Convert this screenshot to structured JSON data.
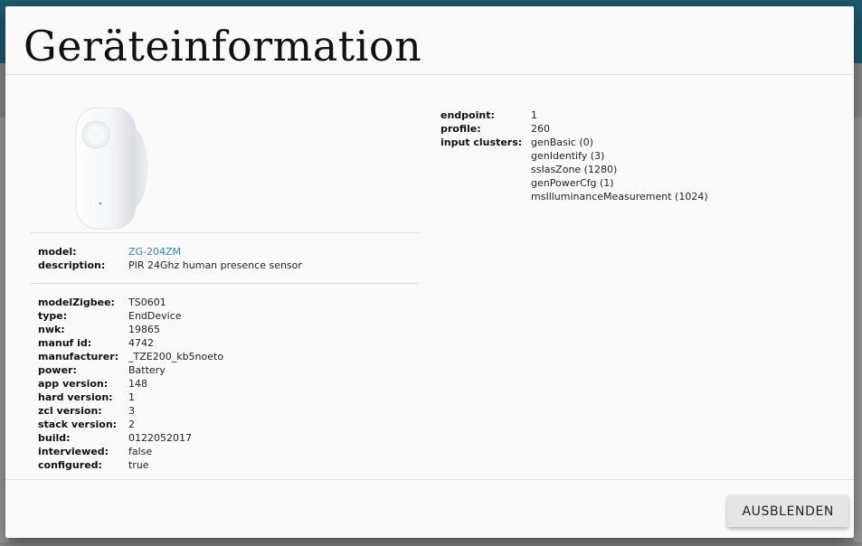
{
  "dialog": {
    "title": "Geräteinformation",
    "hide_button": "AUSBLENDEN"
  },
  "device_summary": {
    "model_label": "model:",
    "model_value": "ZG-204ZM",
    "description_label": "description:",
    "description_value": "PIR 24Ghz human presence sensor"
  },
  "device_details": [
    {
      "label": "modelZigbee:",
      "value": "TS0601"
    },
    {
      "label": "type:",
      "value": "EndDevice"
    },
    {
      "label": "nwk:",
      "value": "19865"
    },
    {
      "label": "manuf id:",
      "value": "4742"
    },
    {
      "label": "manufacturer:",
      "value": "_TZE200_kb5noeto"
    },
    {
      "label": "power:",
      "value": "Battery"
    },
    {
      "label": "app version:",
      "value": "148"
    },
    {
      "label": "hard version:",
      "value": "1"
    },
    {
      "label": "zcl version:",
      "value": "3"
    },
    {
      "label": "stack version:",
      "value": "2"
    },
    {
      "label": "build:",
      "value": "0122052017"
    },
    {
      "label": "interviewed:",
      "value": "false"
    },
    {
      "label": "configured:",
      "value": "true"
    }
  ],
  "endpoint": {
    "endpoint_label": "endpoint:",
    "endpoint_value": "1",
    "profile_label": "profile:",
    "profile_value": "260",
    "input_clusters_label": "input clusters:",
    "input_clusters": [
      "genBasic (0)",
      "genIdentify (3)",
      "ssIasZone (1280)",
      "genPowerCfg (1)",
      "msIlluminanceMeasurement (1024)"
    ]
  },
  "icons": {
    "device_image": "pir-sensor-device-image"
  }
}
